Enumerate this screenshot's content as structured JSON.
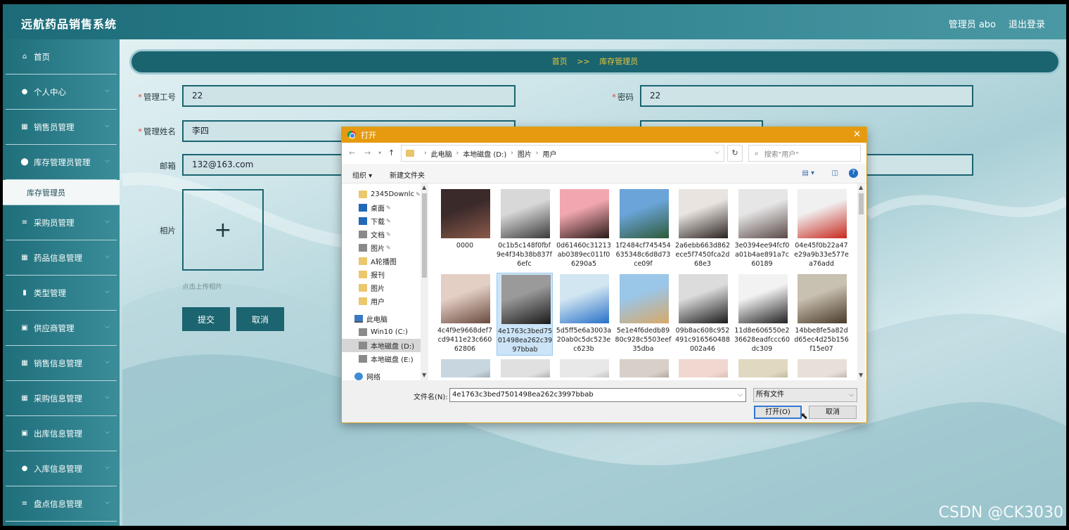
{
  "header": {
    "app_title": "远航药品销售系统",
    "admin_label": "管理员 abo",
    "logout": "退出登录"
  },
  "sidebar": {
    "items": [
      {
        "label": "首页",
        "icon": "home-icon"
      },
      {
        "label": "个人中心",
        "icon": "user-icon"
      },
      {
        "label": "销售员管理",
        "icon": "grid-icon"
      },
      {
        "label": "库存管理员管理",
        "icon": "pin-icon"
      },
      {
        "label": "采购员管理",
        "icon": "list-icon"
      },
      {
        "label": "药品信息管理",
        "icon": "grid-icon"
      },
      {
        "label": "类型管理",
        "icon": "bar-chart-icon"
      },
      {
        "label": "供应商管理",
        "icon": "briefcase-icon"
      },
      {
        "label": "销售信息管理",
        "icon": "grid-icon"
      },
      {
        "label": "采购信息管理",
        "icon": "grid-icon"
      },
      {
        "label": "出库信息管理",
        "icon": "briefcase-icon"
      },
      {
        "label": "入库信息管理",
        "icon": "user-icon"
      },
      {
        "label": "盘点信息管理",
        "icon": "list-icon"
      }
    ],
    "sub_item": "库存管理员"
  },
  "breadcrumb": {
    "home": "首页",
    "separator": ">>",
    "current": "库存管理员"
  },
  "form": {
    "staff_no_label": "管理工号",
    "staff_no_value": "22",
    "password_label": "密码",
    "password_value": "22",
    "name_label": "管理姓名",
    "name_value": "李四",
    "email_label": "邮箱",
    "email_value": "132@163.com",
    "photo_label": "相片",
    "upload_hint": "点击上传相片",
    "submit": "提交",
    "cancel": "取消"
  },
  "watermark": "CSDN @CK3030",
  "dialog": {
    "title": "打开",
    "path": [
      "此电脑",
      "本地磁盘 (D:)",
      "图片",
      "用户"
    ],
    "search_placeholder": "搜索\"用户\"",
    "organize": "组织 ▾",
    "new_folder": "新建文件夹",
    "tree": [
      {
        "label": "2345Downlc",
        "icon": "fold",
        "pinned": true
      },
      {
        "label": "桌面",
        "icon": "blue",
        "pinned": true
      },
      {
        "label": "下载",
        "icon": "blue",
        "pinned": true
      },
      {
        "label": "文档",
        "icon": "gray",
        "pinned": true
      },
      {
        "label": "图片",
        "icon": "gray",
        "pinned": true
      },
      {
        "label": "A轮播图",
        "icon": "fold",
        "pinned": false
      },
      {
        "label": "报刊",
        "icon": "fold",
        "pinned": false
      },
      {
        "label": "图片",
        "icon": "fold",
        "pinned": false
      },
      {
        "label": "用户",
        "icon": "fold",
        "pinned": false
      },
      {
        "label": "此电脑",
        "icon": "pc",
        "pinned": false
      },
      {
        "label": "Win10 (C:)",
        "icon": "gray",
        "pinned": false
      },
      {
        "label": "本地磁盘 (D:)",
        "icon": "gray",
        "pinned": false
      },
      {
        "label": "本地磁盘 (E:)",
        "icon": "gray",
        "pinned": false
      },
      {
        "label": "网络",
        "icon": "net",
        "pinned": false
      }
    ],
    "files": [
      {
        "name": "0000",
        "colors": [
          "#3b2a2a",
          "#8a5a4a"
        ]
      },
      {
        "name": "0c1b5c148f0fbf9e4f34b38b837f6efc",
        "colors": [
          "#d8d8d8",
          "#3a3a3a"
        ]
      },
      {
        "name": "0d61460c31213ab0389ec011f06290a5",
        "colors": [
          "#f2a7b0",
          "#2a1a18"
        ]
      },
      {
        "name": "1f2484cf745454635348c6d8d73ce09f",
        "colors": [
          "#6aa4d8",
          "#2e5a3a"
        ]
      },
      {
        "name": "2a6ebb663d862ece5f7450fca2d68e3",
        "colors": [
          "#e9e4e0",
          "#2a2220"
        ]
      },
      {
        "name": "3e0394ee94fcf0a01b4ae891a7c60189",
        "colors": [
          "#e6e6e6",
          "#5a4a48"
        ]
      },
      {
        "name": "04e45f0b22a47e29a9b33e577ea76add",
        "colors": [
          "#f0f0f0",
          "#c8281e"
        ]
      },
      {
        "name": "4c4f9e9668def7cd9411e23c66062806",
        "colors": [
          "#e4cfc4",
          "#6a4a40"
        ]
      },
      {
        "name": "4e1763c3bed7501498ea262c3997bbab",
        "colors": [
          "#9a9a9a",
          "#1a1a1a"
        ]
      },
      {
        "name": "5d5ff5e6a3003a20ab0c5dc523ec623b",
        "colors": [
          "#d2e6f2",
          "#2870c8"
        ]
      },
      {
        "name": "5e1e4f6dedb8980c928c5503eef35dba",
        "colors": [
          "#9ac6e8",
          "#d8a868"
        ]
      },
      {
        "name": "09b8ac608c952491c916560488002a46",
        "colors": [
          "#dcdcdc",
          "#1a1a1a"
        ]
      },
      {
        "name": "11d8e606550e236628eadfccc60dc309",
        "colors": [
          "#f2f2f2",
          "#222222"
        ]
      },
      {
        "name": "14bbe8fe5a82dd65ec4d25b156f15e07",
        "colors": [
          "#c8c0b0",
          "#4a3a2a"
        ]
      },
      {
        "name": "",
        "colors": [
          "#c8d6e0",
          "#2a2a2a"
        ]
      },
      {
        "name": "",
        "colors": [
          "#e0e0e0",
          "#1a1a1a"
        ]
      },
      {
        "name": "",
        "colors": [
          "#e8e8e8",
          "#5a4a40"
        ]
      },
      {
        "name": "",
        "colors": [
          "#d8d0c8",
          "#2a2020"
        ]
      },
      {
        "name": "",
        "colors": [
          "#f0d8d0",
          "#a86858"
        ]
      },
      {
        "name": "",
        "colors": [
          "#e0d8c0",
          "#5a5040"
        ]
      },
      {
        "name": "",
        "colors": [
          "#e8e0d8",
          "#3a3030"
        ]
      }
    ],
    "selected_file": "4e1763c3bed7501498ea262c3997bbab",
    "filename_label": "文件名(N):",
    "filename_value": "4e1763c3bed7501498ea262c3997bbab",
    "file_type": "所有文件",
    "open_button": "打开(O)",
    "cancel_button": "取消"
  }
}
